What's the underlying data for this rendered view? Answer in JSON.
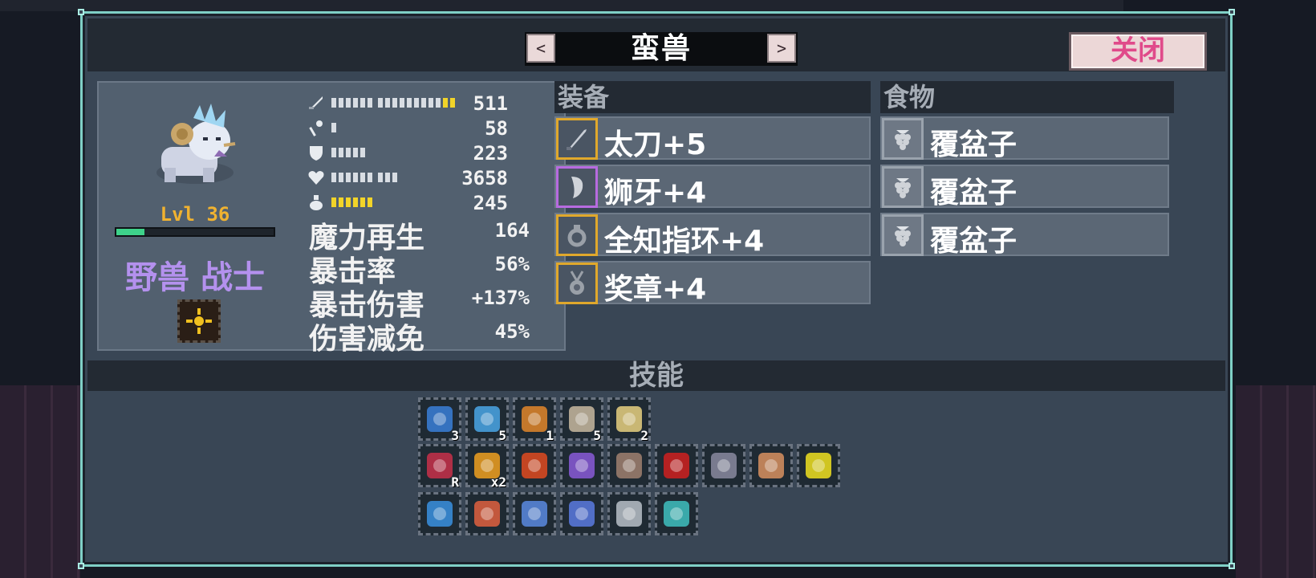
{
  "window": {
    "title": "蛮兽",
    "prev_label": "<",
    "next_label": ">",
    "close_label": "关闭"
  },
  "hero": {
    "level": "Lvl 36",
    "xp_fraction": 0.18,
    "class_name": "野兽 战士",
    "stats": [
      {
        "icon": "sword-icon",
        "value": "511",
        "white": 15,
        "yellow": 2
      },
      {
        "icon": "wand-icon",
        "value": "58",
        "white": 1,
        "yellow": 0
      },
      {
        "icon": "shield-icon",
        "value": "223",
        "white": 5,
        "yellow": 0
      },
      {
        "icon": "heart-icon",
        "value": "3658",
        "white": 9,
        "yellow": 0
      },
      {
        "icon": "mana-potion-icon",
        "value": "245",
        "white": 0,
        "yellow": 6
      }
    ],
    "big_stats": [
      {
        "label": "魔力再生",
        "value": "164"
      },
      {
        "label": "暴击率",
        "value": "56%"
      },
      {
        "label": "暴击伤害",
        "value": "+137%"
      },
      {
        "label": "伤害减免",
        "value": "45%"
      }
    ]
  },
  "equipment": {
    "header": "装备",
    "items": [
      {
        "name": "太刀+5",
        "icon": "katana-icon",
        "rarity": "gold"
      },
      {
        "name": "狮牙+4",
        "icon": "fang-icon",
        "rarity": "purple"
      },
      {
        "name": "全知指环+4",
        "icon": "ring-icon",
        "rarity": "gold"
      },
      {
        "name": "奖章+4",
        "icon": "medal-icon",
        "rarity": "gold"
      }
    ]
  },
  "food": {
    "header": "食物",
    "items": [
      {
        "name": "覆盆子",
        "icon": "raspberry-icon"
      },
      {
        "name": "覆盆子",
        "icon": "raspberry-icon"
      },
      {
        "name": "覆盆子",
        "icon": "raspberry-icon"
      }
    ]
  },
  "skills": {
    "header": "技能",
    "rows": [
      [
        {
          "icon": "chain-slash-skill-icon",
          "count": "3",
          "color": "#3a7fd8"
        },
        {
          "icon": "spirit-face-skill-icon",
          "count": "5",
          "color": "#4aa6e6"
        },
        {
          "icon": "burst-skill-icon",
          "count": "1",
          "color": "#e2862a"
        },
        {
          "icon": "wind-dash-skill-icon",
          "count": "5",
          "color": "#c8b8a0"
        },
        {
          "icon": "spark-skill-icon",
          "count": "2",
          "color": "#e8d080"
        }
      ],
      [
        {
          "icon": "arrow-up-skill-icon",
          "count": "R",
          "color": "#c8304a"
        },
        {
          "icon": "growth-skill-icon",
          "count": "x2",
          "color": "#f0a020"
        },
        {
          "icon": "gear-fire-skill-icon",
          "count": "",
          "color": "#e04a20"
        },
        {
          "icon": "potion-shield-skill-icon",
          "count": "",
          "color": "#8a5ad8"
        },
        {
          "icon": "beast-face-skill-icon",
          "count": "",
          "color": "#a08070"
        },
        {
          "icon": "shadow-skill-icon",
          "count": "",
          "color": "#d02020"
        },
        {
          "icon": "magnifier-skill-icon",
          "count": "",
          "color": "#8a8aa0"
        },
        {
          "icon": "muscle-skill-icon",
          "count": "",
          "color": "#d89060"
        },
        {
          "icon": "wizard-hat-skill-icon",
          "count": "",
          "color": "#f0e020"
        }
      ],
      [
        {
          "icon": "question-skill-icon",
          "count": "",
          "color": "#3a90e0"
        },
        {
          "icon": "flame-crest-skill-icon",
          "count": "",
          "color": "#e06040"
        },
        {
          "icon": "fist-skill-icon",
          "count": "",
          "color": "#5a8ae0"
        },
        {
          "icon": "feather-skill-icon",
          "count": "",
          "color": "#5a7ae0"
        },
        {
          "icon": "timer-skill-icon",
          "count": "",
          "color": "#b8c0c8"
        },
        {
          "icon": "heart-shield-skill-icon",
          "count": "",
          "color": "#40c0c0"
        }
      ]
    ]
  }
}
